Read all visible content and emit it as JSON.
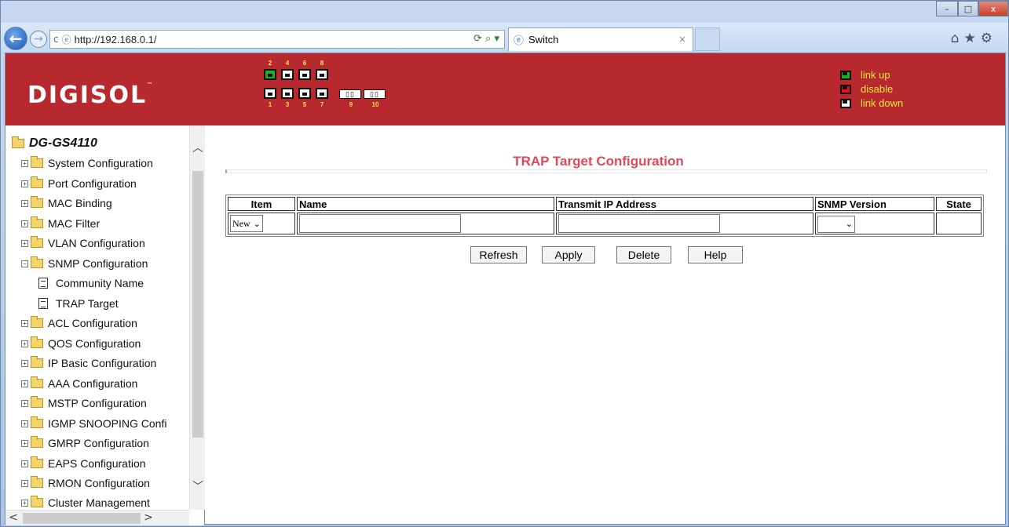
{
  "browser": {
    "url": "http://192.168.0.1/",
    "tab_title": "Switch",
    "back_icon": "←",
    "forward_icon": "→",
    "refresh_icon": "c",
    "close_tab": "×",
    "tools_icons": "⌂★⚙"
  },
  "window_controls": {
    "minimize": "–",
    "maximize": "□",
    "close": "x"
  },
  "header": {
    "brand": "DIGISOL",
    "trademark": "™",
    "ports_top": [
      {
        "num": "2",
        "status": "link up"
      },
      {
        "num": "4",
        "status": "link down"
      },
      {
        "num": "6",
        "status": "link down"
      },
      {
        "num": "8",
        "status": "link down"
      }
    ],
    "ports_bottom": [
      {
        "num": "1",
        "status": "link down"
      },
      {
        "num": "3",
        "status": "link down"
      },
      {
        "num": "5",
        "status": "link down"
      },
      {
        "num": "7",
        "status": "link down"
      }
    ],
    "sfp_ports": [
      {
        "num": "9",
        "glyph": "▯▯"
      },
      {
        "num": "10",
        "glyph": "▯▯"
      }
    ],
    "legend": [
      {
        "label": "link up",
        "color": "#1db21d"
      },
      {
        "label": "disable",
        "color": "#e21616"
      },
      {
        "label": "link down",
        "color": "#ffffff"
      }
    ]
  },
  "sidebar": {
    "root": "DG-GS4110",
    "items": [
      {
        "label": "System Configuration"
      },
      {
        "label": "Port Configuration"
      },
      {
        "label": "MAC Binding"
      },
      {
        "label": "MAC Filter"
      },
      {
        "label": "VLAN Configuration"
      },
      {
        "label": "SNMP Configuration"
      },
      {
        "label": "Community Name"
      },
      {
        "label": "TRAP Target"
      },
      {
        "label": "ACL Configuration"
      },
      {
        "label": "QOS Configuration"
      },
      {
        "label": "IP Basic Configuration"
      },
      {
        "label": "AAA Configuration"
      },
      {
        "label": "MSTP Configuration"
      },
      {
        "label": "IGMP SNOOPING Confi"
      },
      {
        "label": "GMRP Configuration"
      },
      {
        "label": "EAPS Configuration"
      },
      {
        "label": "RMON Configuration"
      },
      {
        "label": "Cluster Management"
      }
    ],
    "expand_glyph": "+",
    "collapse_glyph": "−",
    "scroll_up": "︿",
    "scroll_down": "﹀",
    "scroll_left": "<",
    "scroll_right": ">"
  },
  "main": {
    "title": "TRAP Target Configuration",
    "table": {
      "headers": [
        "Item",
        "Name",
        "Transmit IP Address",
        "SNMP Version",
        "State"
      ],
      "row": {
        "item_select": "New",
        "name_value": "",
        "ip_value": "",
        "snmp_version": "",
        "state": ""
      }
    },
    "buttons": {
      "refresh": "Refresh",
      "apply": "Apply",
      "delete": "Delete",
      "help": "Help"
    },
    "dropdown_arrow": "⌄"
  }
}
